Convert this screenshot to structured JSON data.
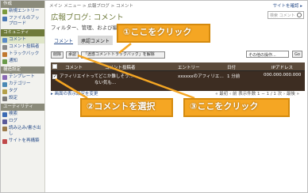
{
  "topbar": {
    "breadcrumb": "メイン メニュー > 広報ブログ > コメント",
    "site_link": "サイトを確認 ▸"
  },
  "sidebar": {
    "sections": [
      {
        "label": "作成",
        "items": [
          "新規エントリー",
          "ファイルのアップロード"
        ]
      },
      {
        "label": "コミュニティ",
        "items": [
          "コメント",
          "コメント投稿者",
          "トラックバック",
          "通知"
        ]
      },
      {
        "label": "構造設定",
        "items": [
          "テンプレート",
          "カテゴリー",
          "タグ",
          "設定"
        ]
      },
      {
        "label": "ユーティリティ",
        "items": [
          "検索",
          "ログ",
          "読み込み/書き出し",
          "サイトを再構築"
        ]
      }
    ]
  },
  "main": {
    "title": "広報ブログ: コメント",
    "search_placeholder": "検索 コメント",
    "subtitle": "フィルター、管理、および編集を行",
    "tabs": [
      "コメント",
      "承認コメント"
    ],
    "toolbar": {
      "delete_label": "削除",
      "approve_label": "承認",
      "junk_label": "「迷惑コメントトラックバック」を解除",
      "other_actions": "その他の操作...",
      "go_label": "Go"
    },
    "table": {
      "headers": [
        "コメント",
        "コメント投稿者",
        "エントリー",
        "日付",
        "IPアドレス"
      ],
      "rows": [
        {
          "comment": "アフィリエイトってどこか難しそう…",
          "comment2": "ない気も…",
          "author": "",
          "entry": "xxxxxxのアフィリエ…",
          "date": "1 分前",
          "ip": "000.000.000.000"
        }
      ]
    },
    "footer_link": "▸ 画面の表示設定を変更",
    "pager": "« 最初 ‹ 前 表示件数 1 − 1 / 1 次 › 最後 »"
  },
  "callouts": {
    "one": "①ここをクリック",
    "two": "②コメントを選択",
    "three": "③ここをクリック"
  },
  "colors": {
    "accent": "#f5a623",
    "callout_border": "#d48a0e",
    "table_header": "#5b4a3a",
    "table_row": "#3d2d22",
    "title": "#6e7a3a",
    "link": "#2a4e8a"
  }
}
